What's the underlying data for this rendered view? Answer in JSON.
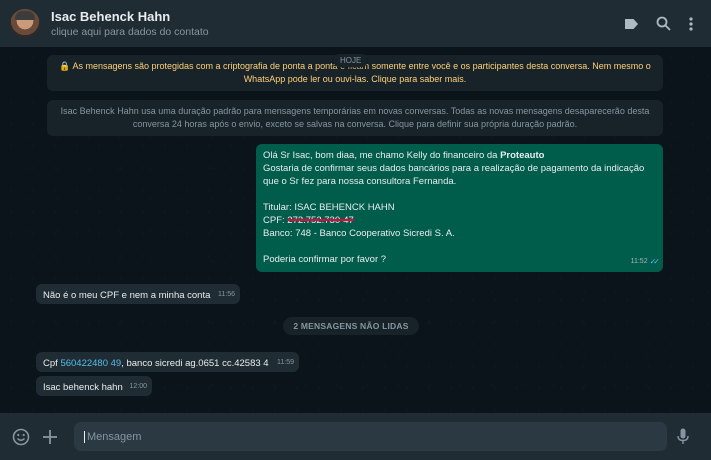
{
  "header": {
    "contact_name": "Isac Behenck Hahn",
    "subtitle": "clique aqui para dados do contato",
    "icons": [
      "label-icon",
      "search-icon",
      "menu-icon"
    ]
  },
  "system": {
    "encryption": "🔒 As mensagens são protegidas com a criptografia de ponta a ponta e ficam somente entre você e os participantes desta conversa. Nem mesmo o WhatsApp pode ler ou ouvi-las. Clique para saber mais.",
    "day_label": "HOJE",
    "temporary": "Isac Behenck Hahn usa uma duração padrão para mensagens temporárias em novas conversas. Todas as novas mensagens desaparecerão desta conversa 24 horas após o envio, exceto se salvas na conversa. Clique para definir sua própria duração padrão."
  },
  "outgoing": {
    "line1_prefix": "Olá Sr Isac, bom diaa, me chamo Kelly do financeiro da ",
    "line1_bold": "Proteauto",
    "line2": "Gostaria de confirmar seus dados bancários para a realização de pagamento da indicação que o Sr fez para nossa consultora Fernanda.",
    "titular": "Titular: ISAC BEHENCK HAHN",
    "cpf_label": "CPF: ",
    "cpf_value": "272.752.730-47",
    "banco": "Banco:  748 - Banco Cooperativo Sicredi S. A.",
    "closing": "Poderia confirmar por favor ?",
    "time": "11:52"
  },
  "incoming1": {
    "text": "Não é o meu CPF e nem a minha conta",
    "time": "11:56"
  },
  "unread_label": "2 MENSAGENS NÃO LIDAS",
  "incoming2": {
    "prefix": "Cpf ",
    "number": "560422480 49",
    "rest": ",  banco sicredi ag.0651 cc.42583 4",
    "time": "11:59"
  },
  "incoming3": {
    "text": "Isac behenck hahn",
    "time": "12:00"
  },
  "composer": {
    "placeholder": "Mensagem"
  },
  "colors": {
    "header_bg": "#202c33",
    "outgoing_bg": "#005c4b",
    "incoming_bg": "#202c33",
    "link": "#53bdeb",
    "system_text": "#ffd279"
  }
}
